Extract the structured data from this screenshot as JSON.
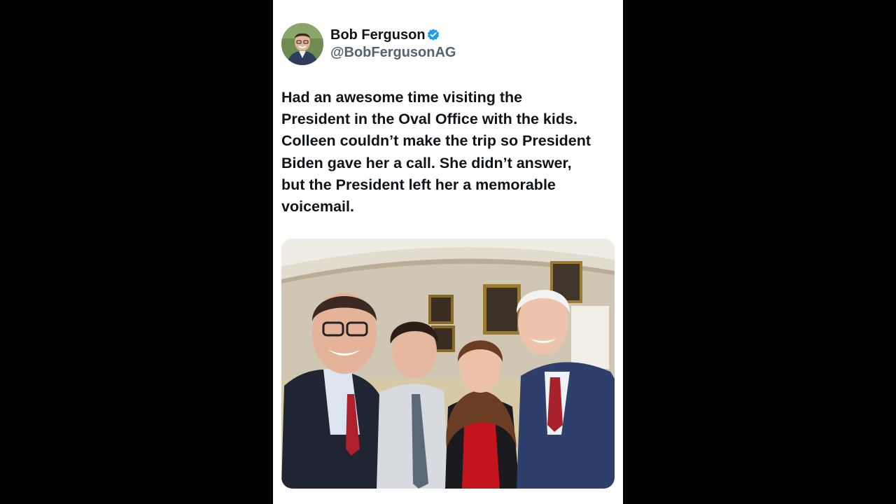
{
  "tweet": {
    "author": {
      "display_name": "Bob Ferguson",
      "handle": "@BobFergusonAG",
      "verified": true,
      "verified_color": "#1d9bf0"
    },
    "text_lines": [
      "Had an awesome time visiting the",
      "President in the Oval Office with the kids.",
      "Colleen couldn’t make the trip so President",
      "Biden gave her a call. She didn’t answer,",
      "but the President left her a memorable",
      "voicemail."
    ],
    "photo": {
      "subject": "group selfie in the Oval Office"
    }
  },
  "colors": {
    "background": "#000000",
    "card": "#ffffff",
    "text_primary": "#0f1419",
    "text_secondary": "#536471"
  }
}
